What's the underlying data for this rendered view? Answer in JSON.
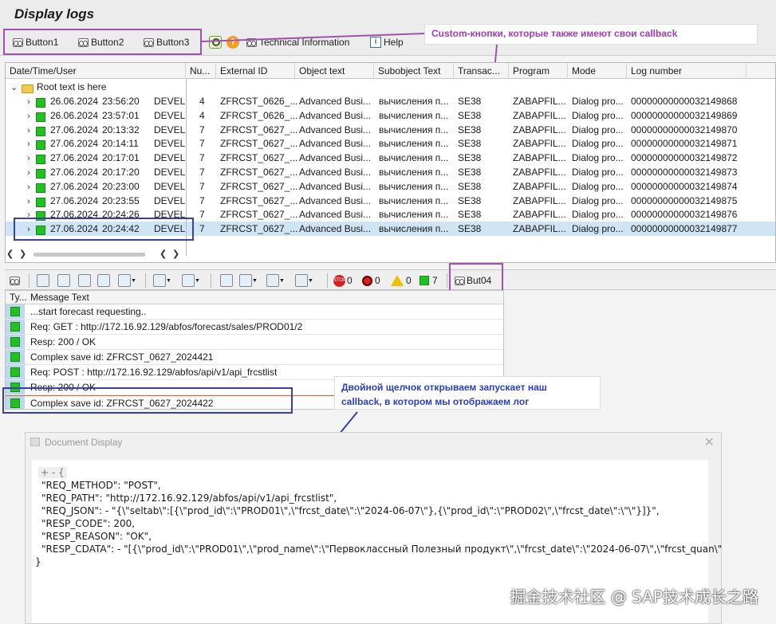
{
  "header": {
    "title": "Display logs"
  },
  "toolbar": {
    "buttons": [
      {
        "label": "Button1",
        "icon": "glasses-icon"
      },
      {
        "label": "Button2",
        "icon": "glasses-icon"
      },
      {
        "label": "Button3",
        "icon": "glasses-icon"
      }
    ],
    "tech_info": "Technical Information",
    "help": "Help"
  },
  "callouts": {
    "custom": "Custom-кнопки, которые также имеют свои callback",
    "dblclick_1": "Двойной щелчок открываем запускает наш",
    "dblclick_2": "callback, в котором мы отображаем лог"
  },
  "log_grid": {
    "columns": [
      "Date/Time/User",
      "Nu...",
      "External ID",
      "Object text",
      "Subobject Text",
      "Transac...",
      "Program",
      "Mode",
      "Log number"
    ],
    "root": "Root text is here",
    "rows": [
      {
        "date": "26.06.2024",
        "time": "23:56:20",
        "user": "DEVELO",
        "num": "4",
        "ext": "ZFRCST_0626_...",
        "obj": "Advanced Busi...",
        "sub": "вычисления п...",
        "tcode": "SE38",
        "prog": "ZABAPFIL...",
        "mode": "Dialog pro...",
        "lognum": "00000000000032149868"
      },
      {
        "date": "26.06.2024",
        "time": "23:57:01",
        "user": "DEVELO",
        "num": "4",
        "ext": "ZFRCST_0626_...",
        "obj": "Advanced Busi...",
        "sub": "вычисления п...",
        "tcode": "SE38",
        "prog": "ZABAPFIL...",
        "mode": "Dialog pro...",
        "lognum": "00000000000032149869"
      },
      {
        "date": "27.06.2024",
        "time": "20:13:32",
        "user": "DEVELO",
        "num": "7",
        "ext": "ZFRCST_0627_...",
        "obj": "Advanced Busi...",
        "sub": "вычисления п...",
        "tcode": "SE38",
        "prog": "ZABAPFIL...",
        "mode": "Dialog pro...",
        "lognum": "00000000000032149870"
      },
      {
        "date": "27.06.2024",
        "time": "20:14:11",
        "user": "DEVELO",
        "num": "7",
        "ext": "ZFRCST_0627_...",
        "obj": "Advanced Busi...",
        "sub": "вычисления п...",
        "tcode": "SE38",
        "prog": "ZABAPFIL...",
        "mode": "Dialog pro...",
        "lognum": "00000000000032149871"
      },
      {
        "date": "27.06.2024",
        "time": "20:17:01",
        "user": "DEVELO",
        "num": "7",
        "ext": "ZFRCST_0627_...",
        "obj": "Advanced Busi...",
        "sub": "вычисления п...",
        "tcode": "SE38",
        "prog": "ZABAPFIL...",
        "mode": "Dialog pro...",
        "lognum": "00000000000032149872"
      },
      {
        "date": "27.06.2024",
        "time": "20:17:20",
        "user": "DEVELO",
        "num": "7",
        "ext": "ZFRCST_0627_...",
        "obj": "Advanced Busi...",
        "sub": "вычисления п...",
        "tcode": "SE38",
        "prog": "ZABAPFIL...",
        "mode": "Dialog pro...",
        "lognum": "00000000000032149873"
      },
      {
        "date": "27.06.2024",
        "time": "20:23:00",
        "user": "DEVELO",
        "num": "7",
        "ext": "ZFRCST_0627_...",
        "obj": "Advanced Busi...",
        "sub": "вычисления п...",
        "tcode": "SE38",
        "prog": "ZABAPFIL...",
        "mode": "Dialog pro...",
        "lognum": "00000000000032149874"
      },
      {
        "date": "27.06.2024",
        "time": "20:23:55",
        "user": "DEVELO",
        "num": "7",
        "ext": "ZFRCST_0627_...",
        "obj": "Advanced Busi...",
        "sub": "вычисления п...",
        "tcode": "SE38",
        "prog": "ZABAPFIL...",
        "mode": "Dialog pro...",
        "lognum": "00000000000032149875"
      },
      {
        "date": "27.06.2024",
        "time": "20:24:26",
        "user": "DEVELO",
        "num": "7",
        "ext": "ZFRCST_0627_...",
        "obj": "Advanced Busi...",
        "sub": "вычисления п...",
        "tcode": "SE38",
        "prog": "ZABAPFIL...",
        "mode": "Dialog pro...",
        "lognum": "00000000000032149876"
      },
      {
        "date": "27.06.2024",
        "time": "20:24:42",
        "user": "DEVELO",
        "num": "7",
        "ext": "ZFRCST_0627_...",
        "obj": "Advanced Busi...",
        "sub": "вычисления п...",
        "tcode": "SE38",
        "prog": "ZABAPFIL...",
        "mode": "Dialog pro...",
        "lognum": "00000000000032149877",
        "selected": true
      }
    ]
  },
  "msg_toolbar": {
    "count_errors_stop": "0",
    "count_errors": "0",
    "count_warnings": "0",
    "count_success": "7",
    "custom_button": "But04"
  },
  "messages": {
    "col_type": "Ty...",
    "col_text": "Message Text",
    "rows": [
      "...start forecast requesting..",
      "Req: GET : http://172.16.92.129/abfos/forecast/sales/PROD01/2",
      "Resp: 200 / OK",
      "Complex save id: ZFRCST_0627_2024421",
      "Req: POST : http://172.16.92.129/abfos/api/v1/api_frcstlist",
      "Resp: 200 / OK",
      "Complex save id: ZFRCST_0627_2024422"
    ]
  },
  "document": {
    "title": "Document Display",
    "ctrl": "+ - {",
    "lines": [
      "\"REQ_METHOD\": \"POST\",",
      "\"REQ_PATH\": \"http://172.16.92.129/abfos/api/v1/api_frcstlist\",",
      "\"REQ_JSON\":  -  \"{\\\"seltab\\\":[{\\\"prod_id\\\":\\\"PROD01\\\",\\\"frcst_date\\\":\\\"2024-06-07\\\"},{\\\"prod_id\\\":\\\"PROD02\\\",\\\"frcst_date\\\":\\\"\\\"}]}\",",
      "\"RESP_CODE\": 200,",
      "\"RESP_REASON\": \"OK\",",
      "\"RESP_CDATA\":  -  \"[{\\\"prod_id\\\":\\\"PROD01\\\",\\\"prod_name\\\":\\\"Первоклассный Полезный продукт\\\",\\\"frcst_date\\\":\\\"2024-06-07\\\",\\\"frcst_quan\\\"",
      "}"
    ]
  },
  "watermark": "掘金技术社区 @ SAP技术成长之路",
  "colors": {
    "success": "#22c122",
    "selection": "#cfe4f4",
    "purple_annot": "#a050b0",
    "blue_annot": "#3b3fa8"
  }
}
